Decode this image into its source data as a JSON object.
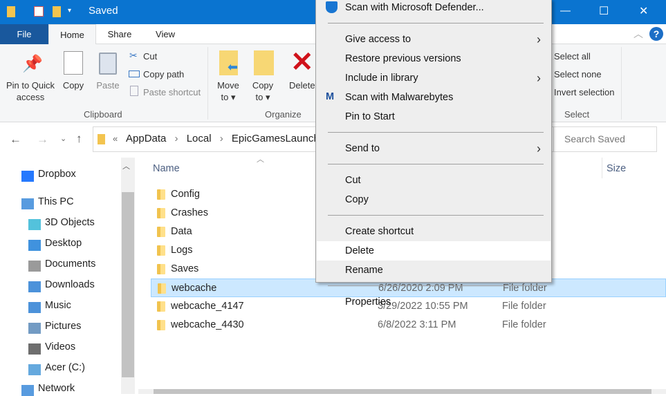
{
  "window": {
    "title": "Saved",
    "minimize": "—",
    "maximize": "☐",
    "close": "✕",
    "accent": "#0a74d0"
  },
  "ribbon_tabs": [
    "File",
    "Home",
    "Share",
    "View"
  ],
  "ribbon": {
    "clipboard": {
      "pin": "Pin to Quick access",
      "copy": "Copy",
      "paste": "Paste",
      "cut": "Cut",
      "copy_path": "Copy path",
      "paste_shortcut": "Paste shortcut",
      "group": "Clipboard"
    },
    "organize": {
      "move_to": "Move to",
      "copy_to": "Copy to",
      "delete": "Delete",
      "group": "Organize"
    },
    "select": {
      "select_all": "Select all",
      "select_none": "Select none",
      "invert": "Invert selection",
      "group": "Select"
    }
  },
  "address": {
    "overflow": "«",
    "crumbs": [
      "AppData",
      "Local",
      "EpicGamesLauncher"
    ],
    "search_placeholder": "Search Saved"
  },
  "nav": [
    "Dropbox",
    "This PC",
    "3D Objects",
    "Desktop",
    "Documents",
    "Downloads",
    "Music",
    "Pictures",
    "Videos",
    "Acer (C:)",
    "Network"
  ],
  "columns": {
    "name": "Name",
    "size": "Size"
  },
  "files": [
    {
      "name": "Config"
    },
    {
      "name": "Crashes"
    },
    {
      "name": "Data"
    },
    {
      "name": "Logs"
    },
    {
      "name": "Saves"
    },
    {
      "name": "webcache",
      "date": "6/26/2020 2:09 PM",
      "type": "File folder",
      "selected": true
    },
    {
      "name": "webcache_4147",
      "date": "3/29/2022 10:55 PM",
      "type": "File folder"
    },
    {
      "name": "webcache_4430",
      "date": "6/8/2022 3:11 PM",
      "type": "File folder"
    }
  ],
  "context_menu": [
    {
      "label": "Scan with Microsoft Defender...",
      "icon": "defender-shield-icon"
    },
    {
      "sep": true
    },
    {
      "label": "Give access to",
      "submenu": true
    },
    {
      "label": "Restore previous versions"
    },
    {
      "label": "Include in library",
      "submenu": true
    },
    {
      "label": "Scan with Malwarebytes",
      "icon": "malwarebytes-icon"
    },
    {
      "label": "Pin to Start"
    },
    {
      "sep": true
    },
    {
      "label": "Send to",
      "submenu": true
    },
    {
      "sep": true
    },
    {
      "label": "Cut"
    },
    {
      "label": "Copy"
    },
    {
      "sep": true
    },
    {
      "label": "Create shortcut"
    },
    {
      "label": "Delete",
      "highlighted": true
    },
    {
      "label": "Rename"
    },
    {
      "sep": true
    },
    {
      "label": "Properties"
    }
  ]
}
